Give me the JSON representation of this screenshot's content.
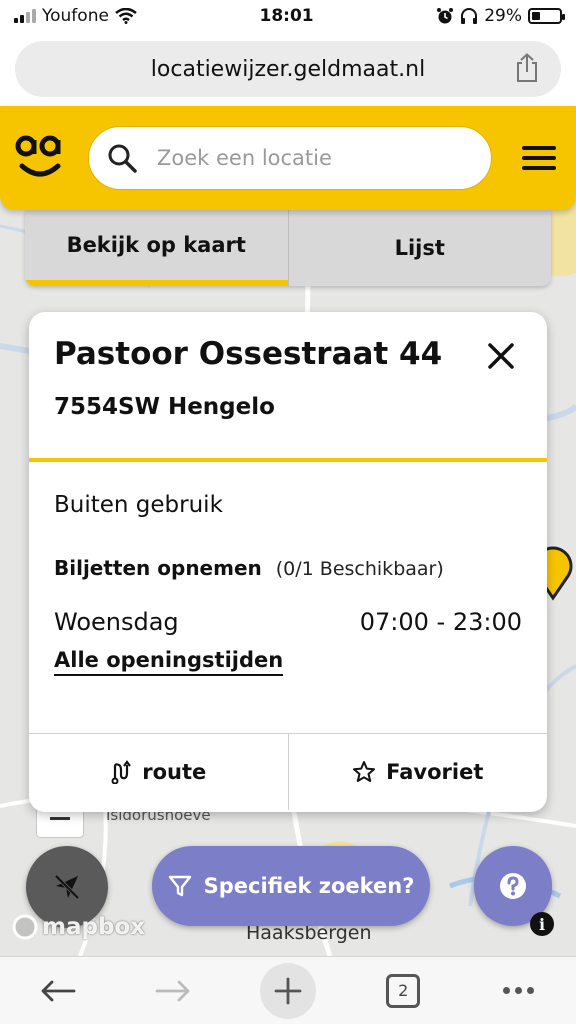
{
  "status_bar": {
    "carrier": "Youfone",
    "time": "18:01",
    "battery": "29%",
    "battery_level": 0.29
  },
  "browser": {
    "url": "locatiewijzer.geldmaat.nl",
    "tab_count": "2"
  },
  "header": {
    "search_placeholder": "Zoek een locatie"
  },
  "view_toggle": {
    "map_label": "Bekijk op kaart",
    "list_label": "Lijst",
    "active": "map"
  },
  "location_card": {
    "street": "Pastoor Ossestraat 44",
    "city": "7554SW Hengelo",
    "status": "Buiten gebruik",
    "service_label": "Biljetten opnemen",
    "service_availability": "(0/1 Beschikbaar)",
    "day": "Woensdag",
    "hours": "07:00 - 23:00",
    "all_hours_link": "Alle openingstijden",
    "route_label": "route",
    "favorite_label": "Favoriet"
  },
  "map": {
    "label_top": "Isidorushoeve",
    "label_bottom": "Haaksbergen",
    "filter_button": "Specifiek zoeken?",
    "attribution": "mapbox"
  },
  "colors": {
    "brand_yellow": "#f7c500",
    "accent_purple": "#7c7ec8"
  }
}
